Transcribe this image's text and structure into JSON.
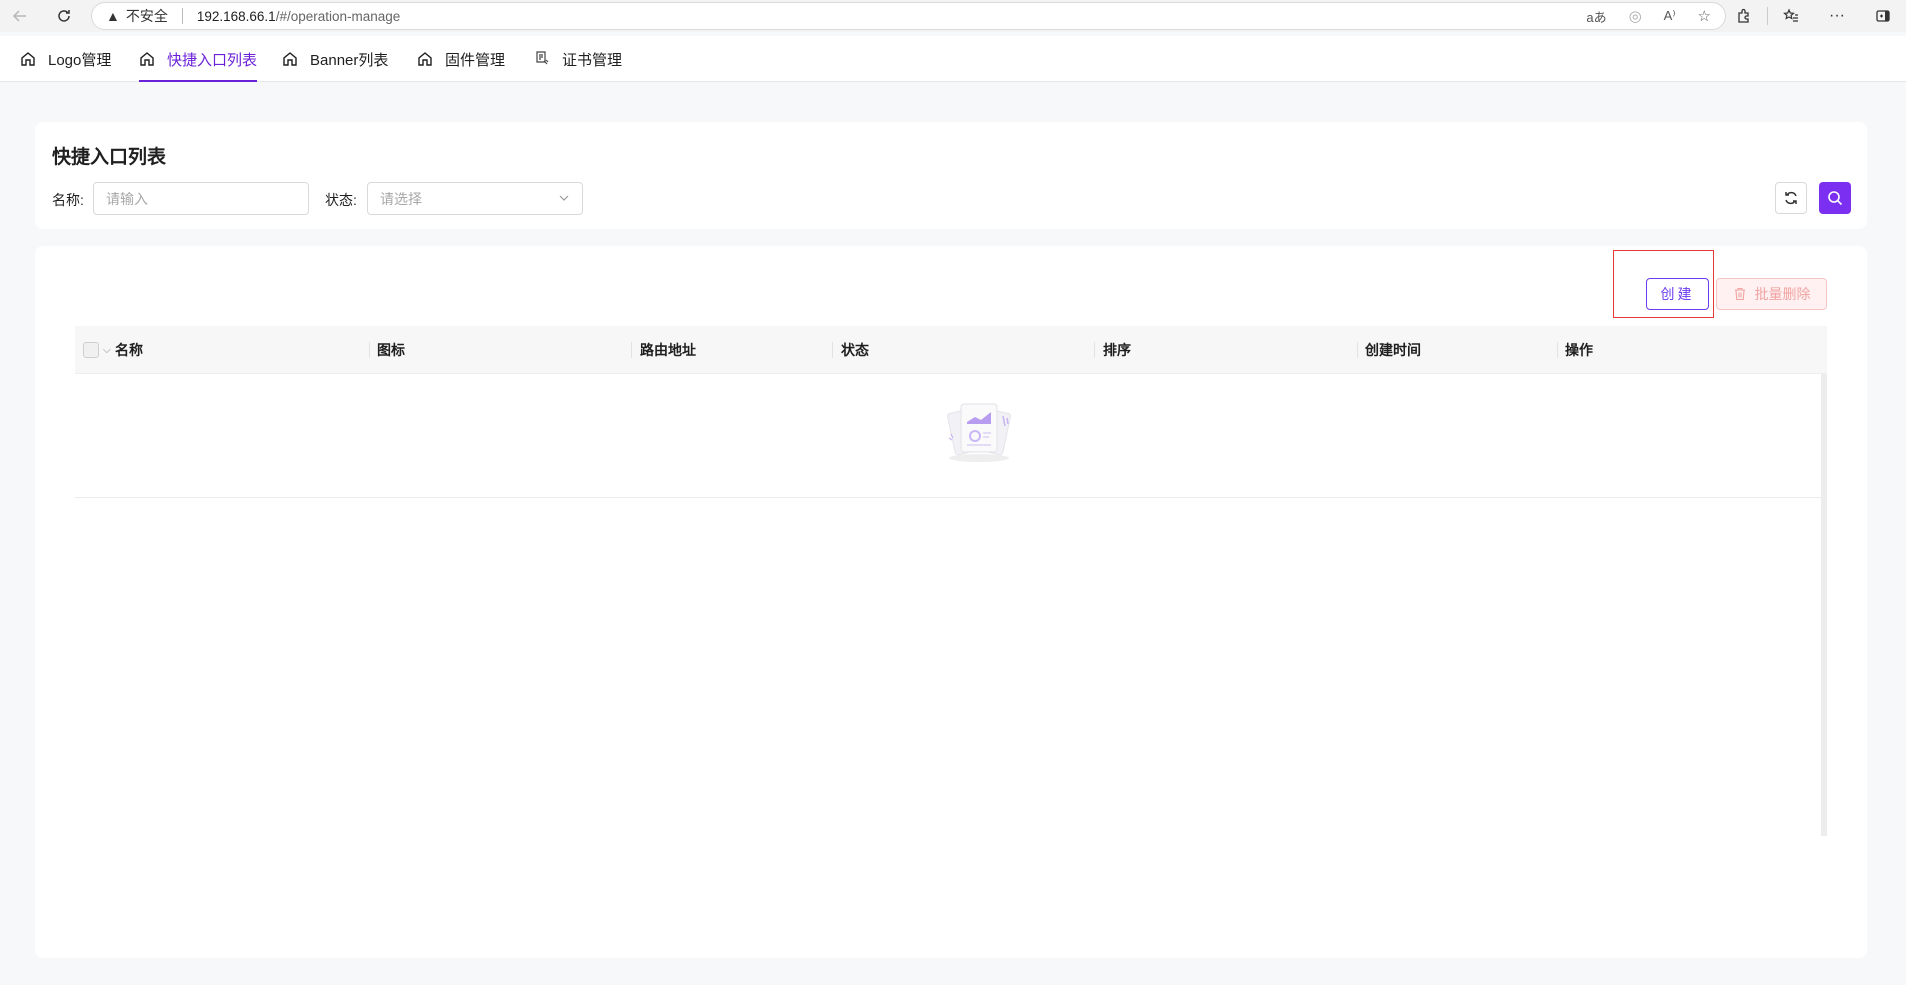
{
  "browser": {
    "not_secure": "不安全",
    "url_host": "192.168.66.1",
    "url_path": "/#/operation-manage"
  },
  "tabs": [
    {
      "label": "Logo管理",
      "icon": "home-icon",
      "active": false
    },
    {
      "label": "快捷入口列表",
      "icon": "home-icon",
      "active": true
    },
    {
      "label": "Banner列表",
      "icon": "home-icon",
      "active": false
    },
    {
      "label": "固件管理",
      "icon": "home-icon",
      "active": false
    },
    {
      "label": "证书管理",
      "icon": "certificate-icon",
      "active": false
    }
  ],
  "accent_color": "#7b2ff0",
  "page": {
    "title": "快捷入口列表"
  },
  "filters": {
    "name_label": "名称:",
    "name_placeholder": "请输入",
    "status_label": "状态:",
    "status_placeholder": "请选择"
  },
  "toolbar": {
    "create_label": "创建",
    "batch_delete_label": "批量删除"
  },
  "table": {
    "columns": [
      "名称",
      "图标",
      "路由地址",
      "状态",
      "排序",
      "创建时间",
      "操作"
    ],
    "rows": []
  }
}
